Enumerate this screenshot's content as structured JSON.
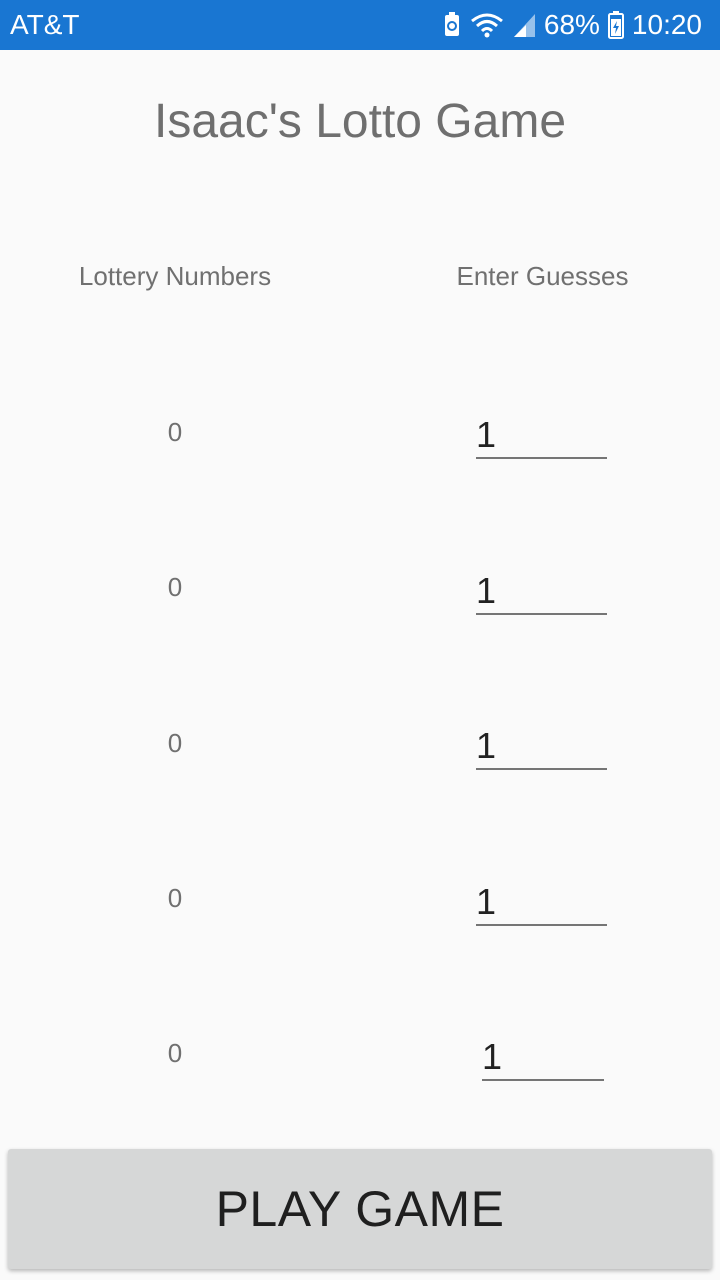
{
  "status_bar": {
    "carrier": "AT&T",
    "battery_percent": "68%",
    "time": "10:20",
    "background_color": "#1976d2",
    "icons": [
      "battery-saver-icon",
      "wifi-icon",
      "cell-signal-icon",
      "battery-icon"
    ]
  },
  "app": {
    "title": "Isaac's Lotto Game"
  },
  "columns": {
    "lottery_header": "Lottery Numbers",
    "guesses_header": "Enter Guesses"
  },
  "rows": [
    {
      "lottery": "0",
      "guess": "1"
    },
    {
      "lottery": "0",
      "guess": "1"
    },
    {
      "lottery": "0",
      "guess": "1"
    },
    {
      "lottery": "0",
      "guess": "1"
    },
    {
      "lottery": "0",
      "guess": "1"
    }
  ],
  "play_button": {
    "label": "PLAY GAME"
  }
}
